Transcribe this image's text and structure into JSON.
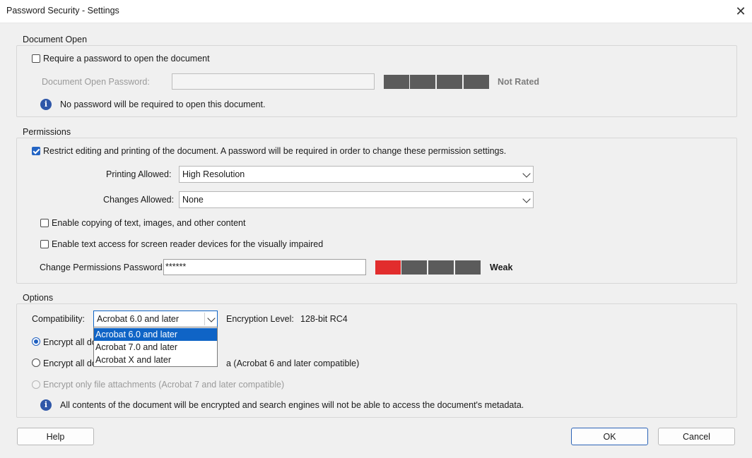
{
  "window": {
    "title": "Password Security - Settings"
  },
  "document_open": {
    "group_label": "Document Open",
    "require_password_label": "Require a password to open the document",
    "require_password_checked": false,
    "password_field_label": "Document Open Password:",
    "password_value": "",
    "strength_label": "Not Rated",
    "info_text": "No password will be required to open this document."
  },
  "permissions": {
    "group_label": "Permissions",
    "restrict_label": "Restrict editing and printing of the document. A password will be required in order to change these permission settings.",
    "restrict_checked": true,
    "printing_label": "Printing Allowed:",
    "printing_value": "High Resolution",
    "changes_label": "Changes Allowed:",
    "changes_value": "None",
    "copy_label": "Enable copying of text, images, and other content",
    "copy_checked": false,
    "screen_reader_label": "Enable text access for screen reader devices for the visually impaired",
    "screen_reader_checked": false,
    "perm_password_label": "Change Permissions Password:",
    "perm_password_value": "******",
    "strength_label": "Weak"
  },
  "options": {
    "group_label": "Options",
    "compat_label": "Compatibility:",
    "compat_value": "Acrobat 6.0 and later",
    "compat_options": [
      "Acrobat 6.0 and later",
      "Acrobat 7.0 and later",
      "Acrobat X and later"
    ],
    "encryption_label": "Encryption  Level:",
    "encryption_value": "128-bit RC4",
    "radio_all_label_visible": "Encrypt all do",
    "radio_except_label_visible_start": "Encrypt all do",
    "radio_except_label_visible_end": "a (Acrobat 6 and later compatible)",
    "radio_attach_label": "Encrypt only file attachments (Acrobat 7 and later compatible)",
    "info_text": "All contents of the document will be encrypted and search engines will not be able to access the document's metadata."
  },
  "footer": {
    "help": "Help",
    "ok": "OK",
    "cancel": "Cancel"
  },
  "colors": {
    "accent": "#0f64c6",
    "strength_weak": "#e22d2d",
    "strength_empty": "#5b5b5b"
  }
}
